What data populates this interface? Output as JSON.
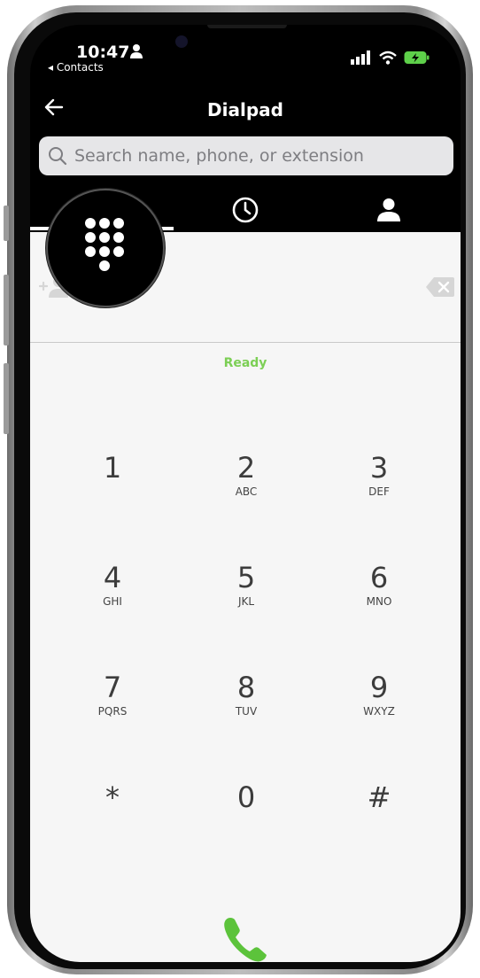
{
  "status_bar": {
    "time": "10:47",
    "back_label": "◂ Contacts"
  },
  "header": {
    "title": "Dialpad"
  },
  "search": {
    "placeholder": "Search name, phone, or extension"
  },
  "tabs": [
    {
      "name": "dialpad",
      "icon": "dialpad-icon",
      "selected": true
    },
    {
      "name": "recents",
      "icon": "clock-icon",
      "selected": false
    },
    {
      "name": "contacts",
      "icon": "person-icon",
      "selected": false
    }
  ],
  "status": {
    "text": "Ready"
  },
  "keypad": {
    "keys": [
      {
        "digit": "1",
        "letters": ""
      },
      {
        "digit": "2",
        "letters": "ABC"
      },
      {
        "digit": "3",
        "letters": "DEF"
      },
      {
        "digit": "4",
        "letters": "GHI"
      },
      {
        "digit": "5",
        "letters": "JKL"
      },
      {
        "digit": "6",
        "letters": "MNO"
      },
      {
        "digit": "7",
        "letters": "PQRS"
      },
      {
        "digit": "8",
        "letters": "TUV"
      },
      {
        "digit": "9",
        "letters": "WXYZ"
      },
      {
        "digit": "*",
        "letters": ""
      },
      {
        "digit": "0",
        "letters": ""
      },
      {
        "digit": "#",
        "letters": ""
      }
    ]
  },
  "colors": {
    "accent_green": "#7ccf55",
    "call_green": "#5cc33b",
    "header_bg": "#000000",
    "content_bg": "#f6f6f6"
  }
}
